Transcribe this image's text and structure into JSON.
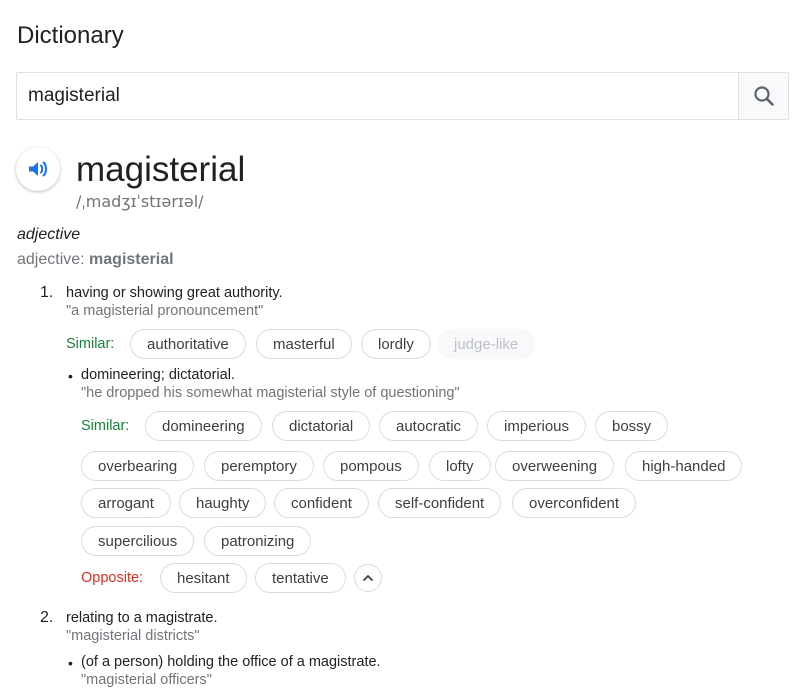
{
  "header": {
    "title": "Dictionary"
  },
  "search": {
    "value": "magisterial"
  },
  "entry": {
    "word": "magisterial",
    "phonetic": "/ˌmadʒɪˈstɪərɪəl/",
    "part_of_speech": "adjective",
    "pos_prefix": "adjective: ",
    "pos_word": "magisterial"
  },
  "senses": [
    {
      "number": "1.",
      "definition": "having or showing great authority.",
      "example": "\"a magisterial pronouncement\"",
      "similar_label": "Similar:",
      "similar": [
        "authoritative",
        "masterful",
        "lordly",
        "judge-like"
      ],
      "subsense": {
        "definition": "domineering; dictatorial.",
        "example": "\"he dropped his somewhat magisterial style of questioning\"",
        "similar_label": "Similar:",
        "similar": [
          "domineering",
          "dictatorial",
          "autocratic",
          "imperious",
          "bossy",
          "overbearing",
          "peremptory",
          "pompous",
          "lofty",
          "overweening",
          "high-handed",
          "arrogant",
          "haughty",
          "confident",
          "self-confident",
          "overconfident",
          "supercilious",
          "patronizing"
        ],
        "opposite_label": "Opposite:",
        "opposite": [
          "hesitant",
          "tentative"
        ]
      }
    },
    {
      "number": "2.",
      "definition": "relating to a magistrate.",
      "example": "\"magisterial districts\"",
      "subsense": {
        "definition": "(of a person) holding the office of a magistrate.",
        "example": "\"magisterial officers\""
      }
    }
  ],
  "icons": {
    "search": "search-icon",
    "speaker": "speaker-icon",
    "collapse": "chevron-up-icon"
  },
  "colors": {
    "similar_label": "#188038",
    "opposite_label": "#d93025",
    "speaker": "#1a73e8",
    "muted": "#70757a"
  }
}
